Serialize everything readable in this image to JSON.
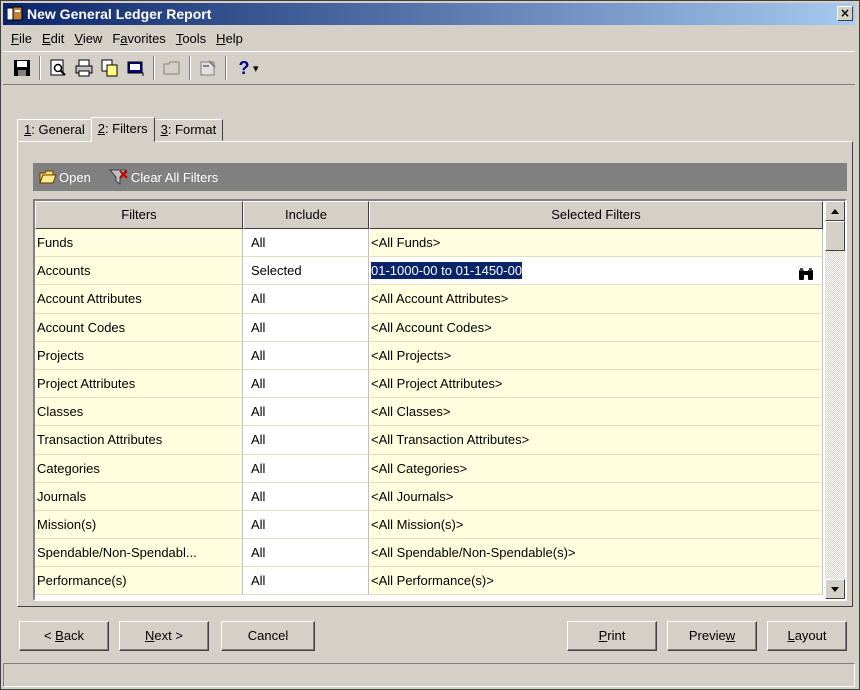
{
  "window": {
    "title": "New General Ledger Report",
    "close_glyph": "×"
  },
  "menu": [
    {
      "label": "File",
      "accel": "F",
      "rest": "ile"
    },
    {
      "label": "Edit",
      "accel": "E",
      "rest": "dit"
    },
    {
      "label": "View",
      "accel": "V",
      "rest": "iew"
    },
    {
      "label": "Favorites",
      "pre": "F",
      "accel": "a",
      "rest": "vorites"
    },
    {
      "label": "Tools",
      "accel": "T",
      "rest": "ools"
    },
    {
      "label": "Help",
      "accel": "H",
      "rest": "elp"
    }
  ],
  "toolbar": {
    "icons": [
      "save-icon",
      "print-preview-icon",
      "print-icon",
      "copy-icon",
      "export-icon",
      "folder-icon",
      "properties-icon",
      "help-icon",
      "dropdown-arrow-icon"
    ],
    "help_glyph": "?",
    "dropdown_glyph": "▾"
  },
  "tabs": [
    {
      "accel": "1",
      "rest": ": General"
    },
    {
      "accel": "2",
      "rest": ": Filters"
    },
    {
      "accel": "3",
      "rest": ": Format"
    }
  ],
  "filters_toolbar": {
    "open_label": "Open",
    "clear_label": "Clear All Filters"
  },
  "grid": {
    "headers": {
      "filters": "Filters",
      "include": "Include",
      "selected": "Selected Filters"
    },
    "rows": [
      {
        "filter": "Funds",
        "include": "All",
        "selected": "<All Funds>"
      },
      {
        "filter": "Accounts",
        "include": "Selected",
        "selected": "01-1000-00 to 01-1450-00"
      },
      {
        "filter": "Account Attributes",
        "include": "All",
        "selected": "<All Account Attributes>"
      },
      {
        "filter": "Account Codes",
        "include": "All",
        "selected": "<All Account Codes>"
      },
      {
        "filter": "Projects",
        "include": "All",
        "selected": "<All Projects>"
      },
      {
        "filter": "Project Attributes",
        "include": "All",
        "selected": "<All Project Attributes>"
      },
      {
        "filter": "Classes",
        "include": "All",
        "selected": "<All Classes>"
      },
      {
        "filter": "Transaction Attributes",
        "include": "All",
        "selected": "<All Transaction Attributes>"
      },
      {
        "filter": "Categories",
        "include": "All",
        "selected": "<All Categories>"
      },
      {
        "filter": "Journals",
        "include": "All",
        "selected": "<All Journals>"
      },
      {
        "filter": "Mission(s)",
        "include": "All",
        "selected": "<All Mission(s)>"
      },
      {
        "filter": "Spendable/Non-Spendabl...",
        "include": "All",
        "selected": "<All Spendable/Non-Spendable(s)>"
      },
      {
        "filter": "Performance(s)",
        "include": "All",
        "selected": "<All Performance(s)>"
      }
    ]
  },
  "buttons": {
    "back": {
      "pre": "< ",
      "accel": "B",
      "rest": "ack"
    },
    "next": {
      "accel": "N",
      "rest": "ext >"
    },
    "cancel": "Cancel",
    "print": {
      "accel": "P",
      "rest": "rint"
    },
    "preview": {
      "pre": "Previe",
      "accel": "w",
      "rest": ""
    },
    "layout": {
      "accel": "L",
      "rest": "ayout"
    }
  },
  "colors": {
    "titlebar_start": "#0a246a",
    "titlebar_end": "#a6caf0",
    "row_bg": "#ffffe0",
    "selection": "#0a246a"
  }
}
